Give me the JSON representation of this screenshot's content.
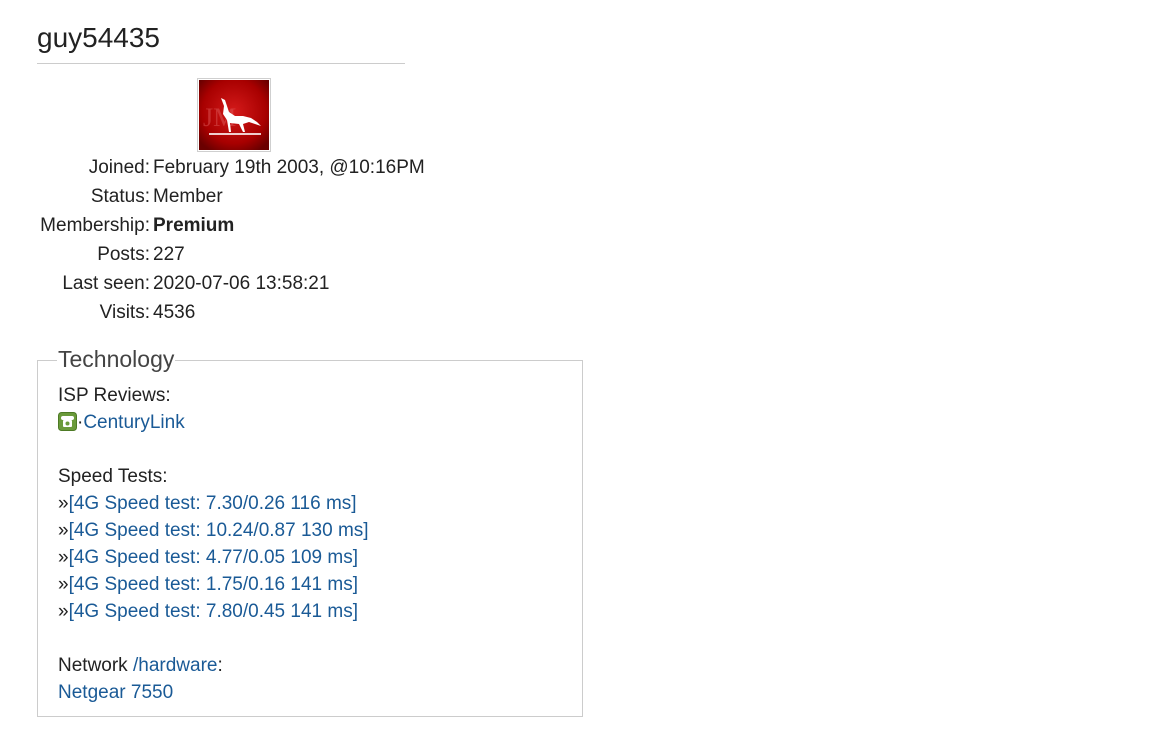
{
  "profile": {
    "username": "guy54435",
    "avatar_icon": "wolf-avatar-icon",
    "details": [
      {
        "label": "Joined:",
        "value": "February 19th 2003, @10:16PM",
        "bold": false
      },
      {
        "label": "Status:",
        "value": "Member",
        "bold": false
      },
      {
        "label": "Membership:",
        "value": "Premium",
        "bold": true
      },
      {
        "label": "Posts:",
        "value": "227",
        "bold": false
      },
      {
        "label": "Last seen:",
        "value": "2020-07-06 13:58:21",
        "bold": false
      },
      {
        "label": "Visits:",
        "value": "4536",
        "bold": false
      }
    ]
  },
  "technology": {
    "legend": "Technology",
    "isp_reviews_label": "ISP Reviews:",
    "isp_icon": "phone-icon",
    "isp_separator": "·",
    "isp_name": "CenturyLink",
    "speed_tests_label": "Speed Tests:",
    "speed_test_prefix": "»",
    "speed_tests": [
      "[4G Speed test: 7.30/0.26 116 ms]",
      "[4G Speed test: 10.24/0.87 130 ms]",
      "[4G Speed test: 4.77/0.05 109 ms]",
      "[4G Speed test: 1.75/0.16 141 ms]",
      "[4G Speed test: 7.80/0.45 141 ms]"
    ],
    "network_label": "Network",
    "hardware_link": "/hardware",
    "network_colon": ":",
    "network_device": "Netgear 7550"
  },
  "colors": {
    "link": "#1a5a96",
    "avatar_red": "#b30000",
    "phone_icon_green": "#6a9a3a"
  }
}
